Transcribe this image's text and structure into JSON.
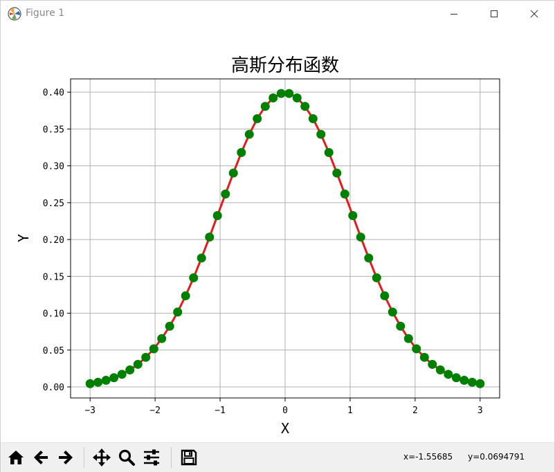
{
  "window": {
    "title": "Figure 1",
    "controls": {
      "minimize": "minimize-icon",
      "maximize": "maximize-icon",
      "close": "close-icon"
    }
  },
  "colors": {
    "line": "#e41a1c",
    "marker": "#008000",
    "grid": "#b0b0b0",
    "axes": "#000000"
  },
  "toolbar": {
    "buttons": [
      "home-icon",
      "back-icon",
      "forward-icon",
      "pan-icon",
      "zoom-icon",
      "configure-subplots-icon",
      "save-icon"
    ],
    "coords": {
      "x": "x=-1.55685",
      "y": "y=0.0694791"
    }
  },
  "chart_data": {
    "type": "line",
    "title": "高斯分布函数",
    "xlabel": "X",
    "ylabel": "Y",
    "xlim": [
      -3.3,
      3.3
    ],
    "ylim": [
      -0.015,
      0.418
    ],
    "xticks": [
      -3,
      -2,
      -1,
      0,
      1,
      2,
      3
    ],
    "xtick_labels": [
      "−3",
      "−2",
      "−1",
      "0",
      "1",
      "2",
      "3"
    ],
    "yticks": [
      0.0,
      0.05,
      0.1,
      0.15,
      0.2,
      0.25,
      0.3,
      0.35,
      0.4
    ],
    "ytick_labels": [
      "0.00",
      "0.05",
      "0.10",
      "0.15",
      "0.20",
      "0.25",
      "0.30",
      "0.35",
      "0.40"
    ],
    "grid": true,
    "series": [
      {
        "x": [
          -3.0,
          -2.878,
          -2.755,
          -2.633,
          -2.51,
          -2.388,
          -2.265,
          -2.143,
          -2.02,
          -1.898,
          -1.776,
          -1.653,
          -1.531,
          -1.408,
          -1.286,
          -1.163,
          -1.041,
          -0.918,
          -0.796,
          -0.673,
          -0.551,
          -0.429,
          -0.306,
          -0.184,
          -0.061,
          0.061,
          0.184,
          0.306,
          0.429,
          0.551,
          0.673,
          0.796,
          0.918,
          1.041,
          1.163,
          1.286,
          1.408,
          1.531,
          1.653,
          1.776,
          1.898,
          2.02,
          2.143,
          2.265,
          2.388,
          2.51,
          2.633,
          2.755,
          2.878,
          3.0
        ],
        "y": [
          0.0044,
          0.0063,
          0.0089,
          0.0125,
          0.0171,
          0.023,
          0.0306,
          0.0401,
          0.0517,
          0.0656,
          0.0823,
          0.1016,
          0.1236,
          0.1481,
          0.1749,
          0.2033,
          0.2325,
          0.2617,
          0.2902,
          0.3181,
          0.3428,
          0.364,
          0.3807,
          0.3922,
          0.3982,
          0.3982,
          0.3922,
          0.3807,
          0.364,
          0.3428,
          0.3181,
          0.2902,
          0.2617,
          0.2325,
          0.2033,
          0.1749,
          0.1481,
          0.1236,
          0.1016,
          0.0823,
          0.0656,
          0.0517,
          0.0401,
          0.0306,
          0.023,
          0.0171,
          0.0125,
          0.0089,
          0.0063,
          0.0044
        ]
      }
    ]
  }
}
